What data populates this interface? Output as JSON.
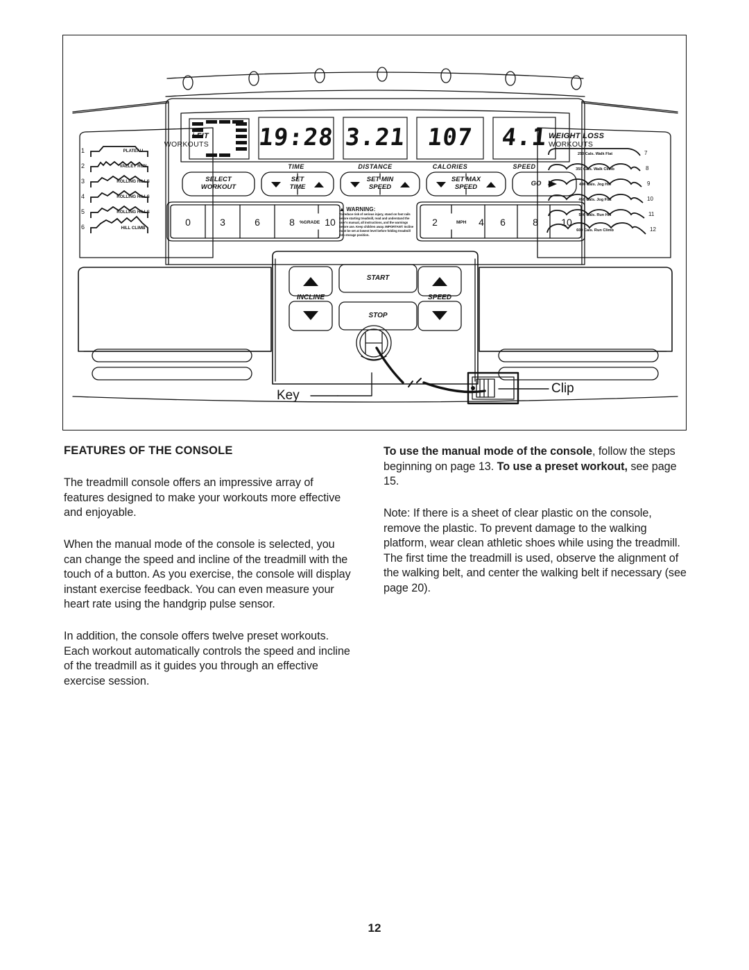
{
  "page": {
    "number": "12"
  },
  "illustration": {
    "console": {
      "display": {
        "readouts": [
          {
            "value": "19:28",
            "label": "TIME"
          },
          {
            "value": "3.21",
            "label": "DISTANCE"
          },
          {
            "value": "107",
            "label": "CALORIES"
          },
          {
            "value": "4.1",
            "label": "SPEED"
          }
        ]
      },
      "ifit_panel": {
        "title_1": "i FIT",
        "title_2": "WORKOUTS",
        "workouts": [
          {
            "num": "1",
            "name": "PLATEAU"
          },
          {
            "num": "2",
            "name": "VALLEY RUN"
          },
          {
            "num": "3",
            "name": "ROLLING HILLS"
          },
          {
            "num": "4",
            "name": "ROLLING HILLS"
          },
          {
            "num": "5",
            "name": "ROLLING HILLS"
          },
          {
            "num": "6",
            "name": "HILL CLIMB"
          }
        ]
      },
      "weight_loss_panel": {
        "title_1": "WEIGHT LOSS",
        "title_2": "WORKOUTS",
        "workouts": [
          {
            "num": "7",
            "cals": "250 Cals.",
            "name": "Walk Flat"
          },
          {
            "num": "8",
            "cals": "350 Cals.",
            "name": "Walk Climb"
          },
          {
            "num": "9",
            "cals": "400 Cals.",
            "name": "Jog Hill"
          },
          {
            "num": "10",
            "cals": "450 Cals.",
            "name": "Jog Flat"
          },
          {
            "num": "11",
            "cals": "500 Cals.",
            "name": "Run Hill"
          },
          {
            "num": "12",
            "cals": "600 Cals.",
            "name": "Run Climb"
          }
        ]
      },
      "function_buttons": [
        {
          "line1": "SELECT",
          "line2": "WORKOUT",
          "arrows": "none"
        },
        {
          "line1": "SET",
          "line2": "TIME",
          "arrows": "both"
        },
        {
          "line1": "SET MIN",
          "line2": "SPEED",
          "arrows": "both"
        },
        {
          "line1": "SET MAX",
          "line2": "SPEED",
          "arrows": "both"
        },
        {
          "line1": "GO",
          "line2": "",
          "arrows": "play"
        }
      ],
      "incline_scale": {
        "unit": "%GRADE",
        "values": [
          "0",
          "3",
          "6",
          "8",
          "10"
        ]
      },
      "speed_scale": {
        "unit": "MPH",
        "values": [
          "2",
          "4",
          "6",
          "8",
          "10"
        ]
      },
      "warning": {
        "title": "WARNING:",
        "text": "To reduce risk of serious injury, stand on foot rails before starting treadmill, read and understand the user's manual, all instructions, and the warnings before use.  Keep children away. IMPORTANT: Incline must be set at lowest level before folding treadmill into storage position."
      },
      "controls": {
        "start_label": "START",
        "stop_label": "STOP",
        "incline_label": "INCLINE",
        "speed_label": "SPEED"
      },
      "callouts": {
        "key": "Key",
        "clip": "Clip"
      }
    }
  },
  "content": {
    "left": {
      "heading": "FEATURES OF THE CONSOLE",
      "p1": "The treadmill console offers an impressive array of features designed to make your workouts more effective and enjoyable.",
      "p2": "When the manual mode of the console is selected, you can change the speed and incline of the treadmill with the touch of a button. As you exercise, the console will display instant exercise feedback. You can even measure your heart rate using the handgrip pulse sensor.",
      "p3": "In addition, the console offers twelve preset workouts. Each workout automatically controls the speed and incline of the treadmill as it guides you through an effective exercise session."
    },
    "right": {
      "p1_bold_a": "To use the manual mode of the console",
      "p1_mid": ", follow the steps beginning on page 13. ",
      "p1_bold_b": "To use a preset workout,",
      "p1_end": " see page 15.",
      "p2": "Note: If there is a sheet of clear plastic on the console, remove the plastic. To prevent damage to the walking platform, wear clean athletic shoes while using the treadmill. The first time the treadmill is used, observe the alignment of the walking belt, and center the walking belt if necessary (see page 20)."
    }
  }
}
